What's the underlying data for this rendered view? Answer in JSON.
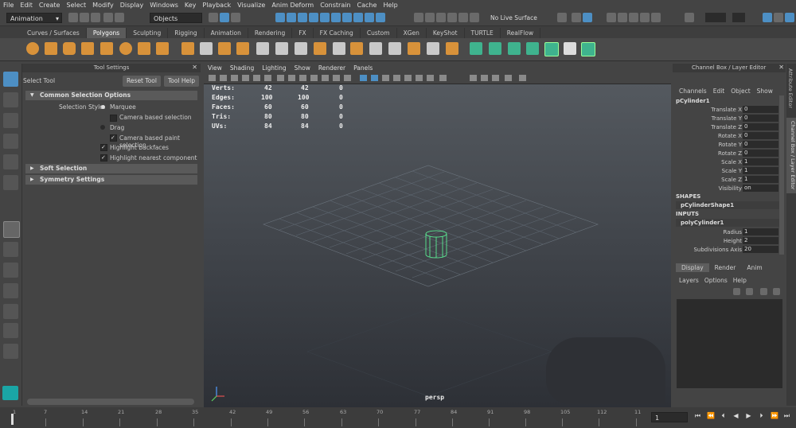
{
  "menu": [
    "File",
    "Edit",
    "Create",
    "Select",
    "Modify",
    "Display",
    "Windows",
    "Key",
    "Playback",
    "Visualize",
    "Anim Deform",
    "Constrain",
    "Cache",
    "Help"
  ],
  "status": {
    "mode": "Animation",
    "objects": "Objects",
    "live_surface": "No Live Surface"
  },
  "shelf_tabs": [
    "Curves / Surfaces",
    "Polygons",
    "Sculpting",
    "Rigging",
    "Animation",
    "Rendering",
    "FX",
    "FX Caching",
    "Custom",
    "XGen",
    "KeyShot",
    "TURTLE",
    "RealFlow"
  ],
  "tool_settings": {
    "header": "Tool Settings",
    "title": "Select Tool",
    "reset_label": "Reset Tool",
    "help_label": "Tool Help",
    "common_section": "Common Selection Options",
    "selection_style_label": "Selection Style:",
    "marquee": "Marquee",
    "camera_based_selection": "Camera based selection",
    "drag": "Drag",
    "camera_based_paint": "Camera based paint selection",
    "highlight_backfaces": "Highlight backfaces",
    "highlight_nearest": "Highlight nearest component",
    "soft_section": "Soft Selection",
    "symmetry_section": "Symmetry Settings"
  },
  "viewport": {
    "menus": [
      "View",
      "Shading",
      "Lighting",
      "Show",
      "Renderer",
      "Panels"
    ],
    "hud": [
      {
        "label": "Verts:",
        "a": "42",
        "b": "42",
        "c": "0"
      },
      {
        "label": "Edges:",
        "a": "100",
        "b": "100",
        "c": "0"
      },
      {
        "label": "Faces:",
        "a": "60",
        "b": "60",
        "c": "0"
      },
      {
        "label": "Tris:",
        "a": "80",
        "b": "80",
        "c": "0"
      },
      {
        "label": "UVs:",
        "a": "84",
        "b": "84",
        "c": "0"
      }
    ],
    "camera_label": "persp",
    "camera_label_small": "persp"
  },
  "channel_box": {
    "header": "Channel Box / Layer Editor",
    "menus": [
      "Channels",
      "Edit",
      "Object",
      "Show"
    ],
    "object": "pCylinder1",
    "attrs": [
      {
        "name": "Translate X",
        "value": "0"
      },
      {
        "name": "Translate Y",
        "value": "0"
      },
      {
        "name": "Translate Z",
        "value": "0"
      },
      {
        "name": "Rotate X",
        "value": "0"
      },
      {
        "name": "Rotate Y",
        "value": "0"
      },
      {
        "name": "Rotate Z",
        "value": "0"
      },
      {
        "name": "Scale X",
        "value": "1"
      },
      {
        "name": "Scale Y",
        "value": "1"
      },
      {
        "name": "Scale Z",
        "value": "1"
      },
      {
        "name": "Visibility",
        "value": "on"
      }
    ],
    "shapes_label": "SHAPES",
    "shape": "pCylinderShape1",
    "inputs_label": "INPUTS",
    "input": "polyCylinder1",
    "input_attrs": [
      {
        "name": "Radius",
        "value": "1"
      },
      {
        "name": "Height",
        "value": "2"
      },
      {
        "name": "Subdivisions Axis",
        "value": "20"
      }
    ],
    "layer_tabs": [
      "Display",
      "Render",
      "Anim"
    ],
    "layer_menus": [
      "Layers",
      "Options",
      "Help"
    ]
  },
  "side_tabs": [
    "Attribute Editor",
    "Channel Box / Layer Editor"
  ],
  "timeline": {
    "ticks": [
      "1",
      "7",
      "14",
      "21",
      "28",
      "35",
      "42",
      "49",
      "56",
      "63",
      "70",
      "77",
      "84",
      "91",
      "98",
      "105",
      "112",
      "11"
    ],
    "current_frame": "1"
  }
}
